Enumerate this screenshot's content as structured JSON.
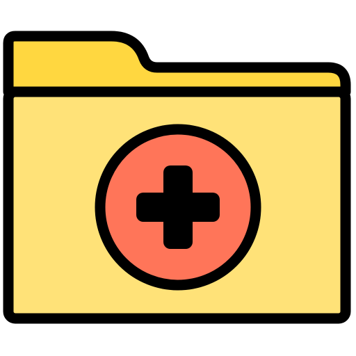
{
  "icon": {
    "name": "add-folder-icon",
    "parts": {
      "folder": "folder-icon",
      "badge": "plus-circle-icon",
      "symbol": "plus-icon"
    },
    "colors": {
      "outline": "#000000",
      "folder_tab": "#FFD740",
      "folder_body": "#FFE278",
      "badge_fill": "#FF7559",
      "plus": "#000000",
      "background": "#FFFFFF"
    }
  }
}
